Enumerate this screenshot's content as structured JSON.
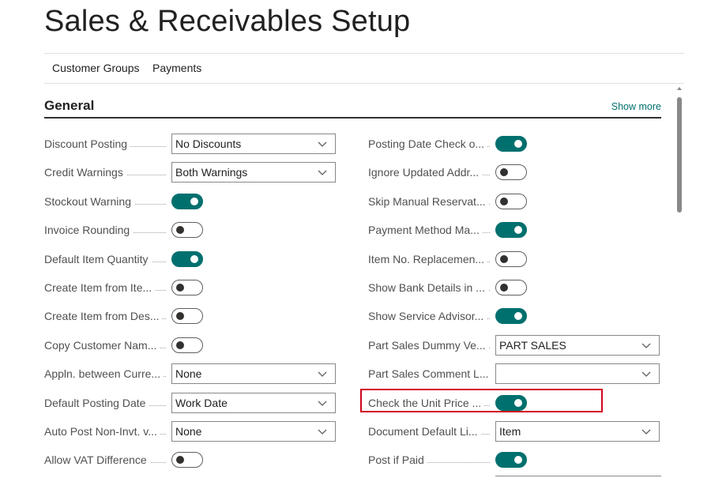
{
  "page": {
    "title": "Sales & Receivables Setup"
  },
  "actions": [
    {
      "label": "Customer Groups"
    },
    {
      "label": "Payments"
    }
  ],
  "section": {
    "title": "General",
    "show_more": "Show more"
  },
  "left_fields": [
    {
      "label": "Discount Posting",
      "type": "select",
      "value": "No Discounts"
    },
    {
      "label": "Credit Warnings",
      "type": "select",
      "value": "Both Warnings"
    },
    {
      "label": "Stockout Warning",
      "type": "toggle",
      "on": true
    },
    {
      "label": "Invoice Rounding",
      "type": "toggle",
      "on": false
    },
    {
      "label": "Default Item Quantity",
      "type": "toggle",
      "on": true
    },
    {
      "label": "Create Item from Ite...",
      "type": "toggle",
      "on": false
    },
    {
      "label": "Create Item from Des...",
      "type": "toggle",
      "on": false
    },
    {
      "label": "Copy Customer Nam...",
      "type": "toggle",
      "on": false
    },
    {
      "label": "Appln. between Curre...",
      "type": "select",
      "value": "None"
    },
    {
      "label": "Default Posting Date",
      "type": "select",
      "value": "Work Date"
    },
    {
      "label": "Auto Post Non-Invt. v...",
      "type": "select",
      "value": "None"
    },
    {
      "label": "Allow VAT Difference",
      "type": "toggle",
      "on": false
    }
  ],
  "right_fields": [
    {
      "label": "Posting Date Check o...",
      "type": "toggle",
      "on": true
    },
    {
      "label": "Ignore Updated Addr...",
      "type": "toggle",
      "on": false
    },
    {
      "label": "Skip Manual Reservat...",
      "type": "toggle",
      "on": false
    },
    {
      "label": "Payment Method Ma...",
      "type": "toggle",
      "on": true
    },
    {
      "label": "Item No. Replacemen...",
      "type": "toggle",
      "on": false
    },
    {
      "label": "Show Bank Details in ...",
      "type": "toggle",
      "on": false
    },
    {
      "label": "Show Service Advisor...",
      "type": "toggle",
      "on": true
    },
    {
      "label": "Part Sales Dummy Ve...",
      "type": "select",
      "value": "PART SALES"
    },
    {
      "label": "Part Sales Comment L...",
      "type": "select",
      "value": ""
    },
    {
      "label": "Check the Unit Price ...",
      "type": "toggle",
      "on": true
    },
    {
      "label": "Document Default Li...",
      "type": "select",
      "value": "Item"
    },
    {
      "label": "Post if Paid",
      "type": "toggle",
      "on": true
    }
  ],
  "colors": {
    "accent": "#00706e",
    "highlight": "#d0021b"
  },
  "icons": {
    "dropdown": "chevron-down-icon",
    "scroll_up": "scroll-up-arrow-icon"
  }
}
